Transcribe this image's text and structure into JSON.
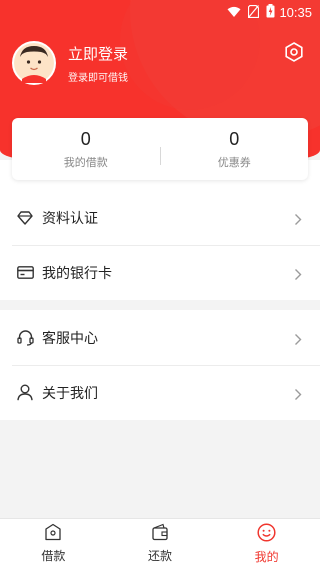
{
  "status_bar": {
    "time": "10:35"
  },
  "profile": {
    "login_text": "立即登录",
    "subtitle": "登录即可借钱"
  },
  "stats": [
    {
      "value": "0",
      "label": "我的借款"
    },
    {
      "value": "0",
      "label": "优惠券"
    }
  ],
  "menu_sections": [
    [
      {
        "label": "资料认证",
        "icon": "diamond-icon"
      },
      {
        "label": "我的银行卡",
        "icon": "card-icon"
      }
    ],
    [
      {
        "label": "客服中心",
        "icon": "headset-icon"
      },
      {
        "label": "关于我们",
        "icon": "person-icon"
      }
    ]
  ],
  "bottom_nav": [
    {
      "label": "借款",
      "icon": "home-box-icon",
      "active": false
    },
    {
      "label": "还款",
      "icon": "wallet-icon",
      "active": false
    },
    {
      "label": "我的",
      "icon": "smile-icon",
      "active": true
    }
  ],
  "colors": {
    "accent": "#f7322c",
    "active_tab": "#f0362e"
  }
}
